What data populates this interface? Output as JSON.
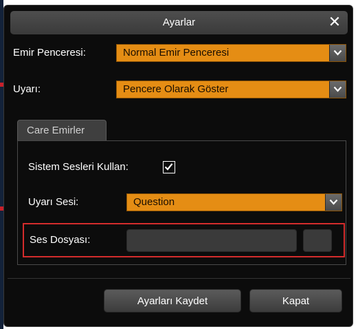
{
  "dialog": {
    "title": "Ayarlar",
    "close_glyph": "✕"
  },
  "order_window": {
    "label": "Emir Penceresi:",
    "selected": "Normal Emir Penceresi"
  },
  "warning": {
    "label": "Uyarı:",
    "selected": "Pencere Olarak Göster"
  },
  "tabs": [
    {
      "label": "Care Emirler",
      "active": true
    }
  ],
  "care_orders": {
    "system_sounds": {
      "label": "Sistem Sesleri Kullan:",
      "checked": true
    },
    "warning_sound": {
      "label": "Uyarı Sesi:",
      "selected": "Question"
    },
    "sound_file": {
      "label": "Ses Dosyası:",
      "value": ""
    }
  },
  "footer": {
    "save_label": "Ayarları Kaydet",
    "close_label": "Kapat"
  },
  "icons": {
    "close": "close-icon",
    "dropdown": "chevron-down-icon",
    "checkbox": "checkmark-icon"
  },
  "colors": {
    "accent": "#e58d14",
    "background": "#0c0c0c",
    "highlight": "#d42c2c"
  }
}
